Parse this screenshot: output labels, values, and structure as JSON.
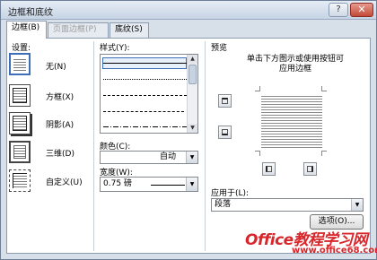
{
  "window": {
    "title": "边框和底纹",
    "help_glyph": "?",
    "close_glyph": "✕"
  },
  "tabs": [
    {
      "label": "边框(B)",
      "active": true
    },
    {
      "label": "页面边框(P)",
      "active": false,
      "disabled": true
    },
    {
      "label": "底纹(S)",
      "active": false
    }
  ],
  "settings": {
    "heading": "设置:",
    "items": [
      {
        "label": "无(N)",
        "selected": true,
        "icon": "setting-none-icon"
      },
      {
        "label": "方框(X)",
        "selected": false,
        "icon": "setting-box-icon"
      },
      {
        "label": "阴影(A)",
        "selected": false,
        "icon": "setting-shadow-icon"
      },
      {
        "label": "三维(D)",
        "selected": false,
        "icon": "setting-3d-icon"
      },
      {
        "label": "自定义(U)",
        "selected": false,
        "icon": "setting-custom-icon"
      }
    ]
  },
  "style": {
    "heading": "样式(Y):",
    "items": [
      {
        "name": "solid",
        "selected": true
      },
      {
        "name": "dotted"
      },
      {
        "name": "dashed-small"
      },
      {
        "name": "dashed-large"
      },
      {
        "name": "dash-dot"
      }
    ]
  },
  "color": {
    "heading": "颜色(C):",
    "value": "自动"
  },
  "width": {
    "heading": "宽度(W):",
    "value": "0.75 磅"
  },
  "preview": {
    "heading": "预览",
    "hint_line1": "单击下方图示或使用按钮可",
    "hint_line2": "应用边框"
  },
  "apply_to": {
    "heading": "应用于(L):",
    "value": "段落"
  },
  "buttons": {
    "options": "选项(O)..."
  },
  "watermark": {
    "main": "Office教程学习网",
    "url": "www.office68.com"
  },
  "colors": {
    "accent": "#3c6fb5",
    "watermark": "#d8262a"
  }
}
